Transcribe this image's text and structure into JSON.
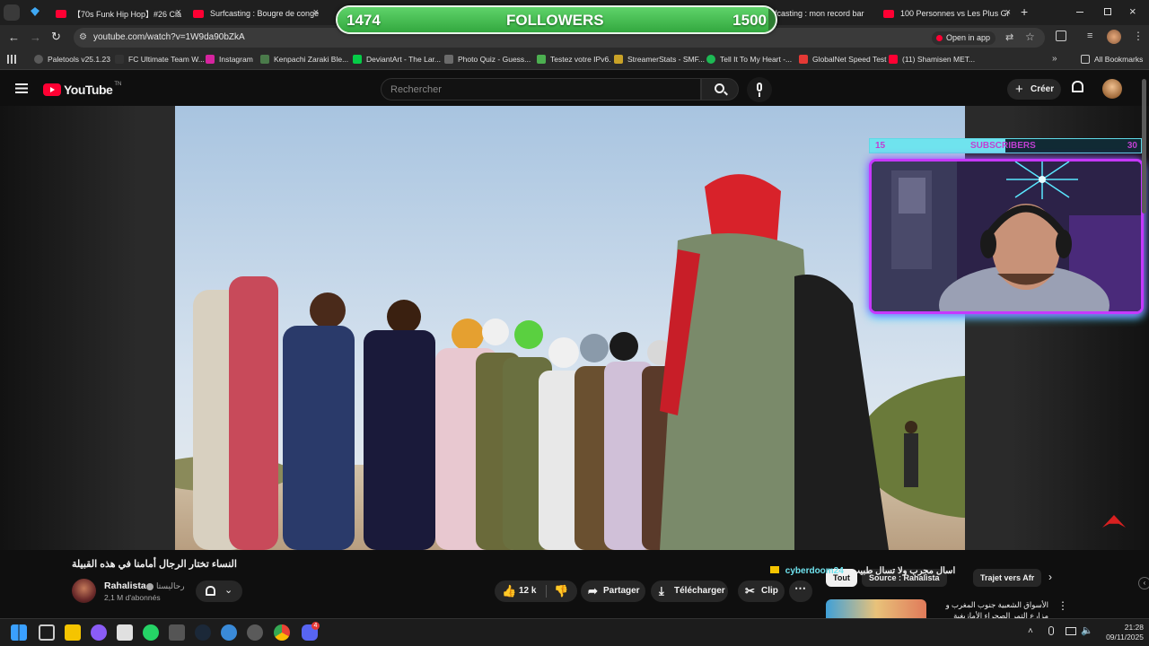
{
  "browser": {
    "tabs": [
      {
        "title": "【70s Funk Hip Hop】#26 Classi",
        "active": false
      },
      {
        "title": "Surfcasting : Bougre de conge",
        "active": false
      },
      {
        "title": "rfcasting : mon record bar",
        "active": false
      },
      {
        "title": "100 Personnes vs Les Plus Gr",
        "active": false
      }
    ],
    "url": "youtube.com/watch?v=1W9da90bZkA",
    "open_in_app": "Open in app",
    "bookmarks": [
      {
        "label": "Paletools v25.1.23",
        "color": "#5a5a5a"
      },
      {
        "label": "FC Ultimate Team W...",
        "color": "#333333"
      },
      {
        "label": "Instagram",
        "color": "#d6249f"
      },
      {
        "label": "Kenpachi Zaraki Ble...",
        "color": "#4a7a4a"
      },
      {
        "label": "DeviantArt - The Lar...",
        "color": "#05cc47"
      },
      {
        "label": "Photo Quiz - Guess...",
        "color": "#6b6b6b"
      },
      {
        "label": "Testez votre IPv6.",
        "color": "#4caf50"
      },
      {
        "label": "StreamerStats - SMF...",
        "color": "#c9a227"
      },
      {
        "label": "Tell It To My Heart -...",
        "color": "#1db954"
      },
      {
        "label": "GlobalNet Speed Test",
        "color": "#e53935"
      },
      {
        "label": "(11) Shamisen MET...",
        "color": "#ff0033"
      }
    ],
    "all_bookmarks": "All Bookmarks"
  },
  "youtube": {
    "logo": "YouTube",
    "logo_region": "TN",
    "search_placeholder": "Rechercher",
    "create_label": "Créer",
    "video_title": "النساء تختار الرجال أمامنا في هذه القبيلة",
    "channel": {
      "name": "Rahalista",
      "name_ar": "رحاليستا",
      "subscribers": "2,1 M d'abonnés"
    },
    "actions": {
      "likes": "12 k",
      "share": "Partager",
      "download": "Télécharger",
      "clip": "Clip"
    },
    "chips": [
      "Tout",
      "Source : Rahalista",
      "Trajet vers Afr"
    ],
    "chat_user": "cyberdoom24",
    "chat_message": "اسأل مجرب ولا تسأل طبيب",
    "rec_title": "الأسواق الشعبية جنوب المغرب و مزارع التمر الصحراء الأمازيغية"
  },
  "overlay": {
    "followers_current": "1474",
    "followers_label": "FOLLOWERS",
    "followers_goal": "1500",
    "followers_progress": 0.983,
    "subs_current": "15",
    "subs_label": "SUBSCRIBERS",
    "subs_goal": "30",
    "subs_progress": 0.5
  },
  "taskbar": {
    "time": "21:28",
    "date": "09/11/2025",
    "discord_badge": "4"
  },
  "colors": {
    "accent_red": "#ff0033",
    "followers_green": "#4caf50",
    "subs_cyan": "#6fe3ee",
    "webcam_border": "#c638ff"
  }
}
